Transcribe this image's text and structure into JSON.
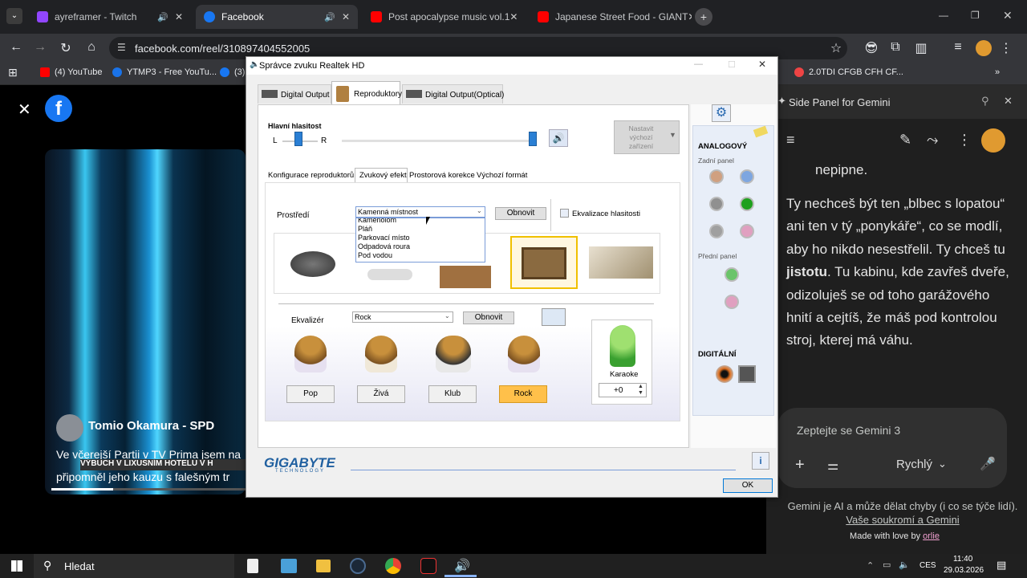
{
  "browser": {
    "tabs": [
      {
        "title": "ayreframer - Twitch",
        "color": "#9146ff",
        "active": false
      },
      {
        "title": "Facebook",
        "color": "#1877f2",
        "active": true
      },
      {
        "title": "Post apocalypse music vol.1",
        "color": "#ff0000",
        "active": false
      },
      {
        "title": "Japanese Street Food - GIANT",
        "color": "#ff0000",
        "active": false
      }
    ],
    "new_tab": "+",
    "url": "facebook.com/reel/310897404552005",
    "bookmarks": [
      {
        "label": "(4) YouTube",
        "color": "#ff0000"
      },
      {
        "label": "YTMP3 - Free YouTu...",
        "color": "#1a73e8"
      },
      {
        "label": "(3)",
        "color": "#1877f2"
      },
      {
        "label": "2.0TDI CFGB CFH CF...",
        "color": "#e44"
      }
    ]
  },
  "facebook": {
    "close": "✕",
    "author": "Tomio Okamura - SPD",
    "caption_line1": "Ve včerejší Partii v TV Prima jsem na",
    "caption_overlay": "VÝBUCH V LIXUSNÍM HOTELU V H",
    "caption_line2": "připomněl jeho kauzu s falešným tr"
  },
  "gemini": {
    "title": "Side Panel for Gemini",
    "text_top": "nepipne.",
    "paragraph": "Ty nechceš být ten „blbec s lopatou“ ani ten v tý „ponykáře“, co se modlí, aby ho nikdo nesestřelil. Ty chceš tu",
    "bold_word": "jistotu",
    "paragraph2": ". Tu kabinu, kde zavřeš dveře, odizoluješ se od toho garážového hnití a cejtíš, že máš pod kontrolou stroj, kterej má váhu.",
    "input_placeholder": "Zeptejte se Gemini 3",
    "mode": "Rychlý",
    "disclaimer": "Gemini je AI a může dělat chyby (i co se týče lidí).",
    "privacy_link": "Vaše soukromí a Gemini",
    "made_with": "Made with love by",
    "made_by": "orlie"
  },
  "dialog": {
    "title": "Správce zvuku Realtek HD",
    "device_tabs": [
      "Digital Output",
      "Reproduktory",
      "Digital Output(Optical)"
    ],
    "main_volume_label": "Hlavní hlasitost",
    "left": "L",
    "right": "R",
    "default_device": "Nastavit výchozí zařízení",
    "sub_tabs": [
      "Konfigurace reproduktorů",
      "Zvukový efekt",
      "Prostorová korekce",
      "Výchozí formát"
    ],
    "environment_label": "Prostředí",
    "environment_selected": "Kamenná místnost",
    "environment_options": [
      "Kamenolom",
      "Pláň",
      "Parkovací místo",
      "Odpadová roura",
      "Pod vodou"
    ],
    "reset": "Obnovit",
    "loudness_label": "Ekvalizace hlasitosti",
    "equalizer_label": "Ekvalizér",
    "equalizer_selected": "Rock",
    "presets": [
      "Pop",
      "Živá",
      "Klub",
      "Rock"
    ],
    "karaoke_label": "Karaoke",
    "karaoke_value": "+0",
    "analog_title": "ANALOGOVÝ",
    "rear_panel": "Zadní panel",
    "front_panel": "Přední panel",
    "digital_title": "DIGITÁLNÍ",
    "brand": "GIGABYTE",
    "brand_sub": "TECHNOLOGY",
    "ok": "OK",
    "jack_colors": [
      "#d0a080",
      "#7ea6e0",
      "#909090",
      "#1ea01e",
      "#a0a0a0",
      "#e0a0c0"
    ],
    "front_jacks": [
      "#6ac46a",
      "#e0a0c0"
    ]
  },
  "taskbar": {
    "search": "Hledat",
    "time": "11:40",
    "date": "29.03.2026",
    "lang": "CES"
  }
}
